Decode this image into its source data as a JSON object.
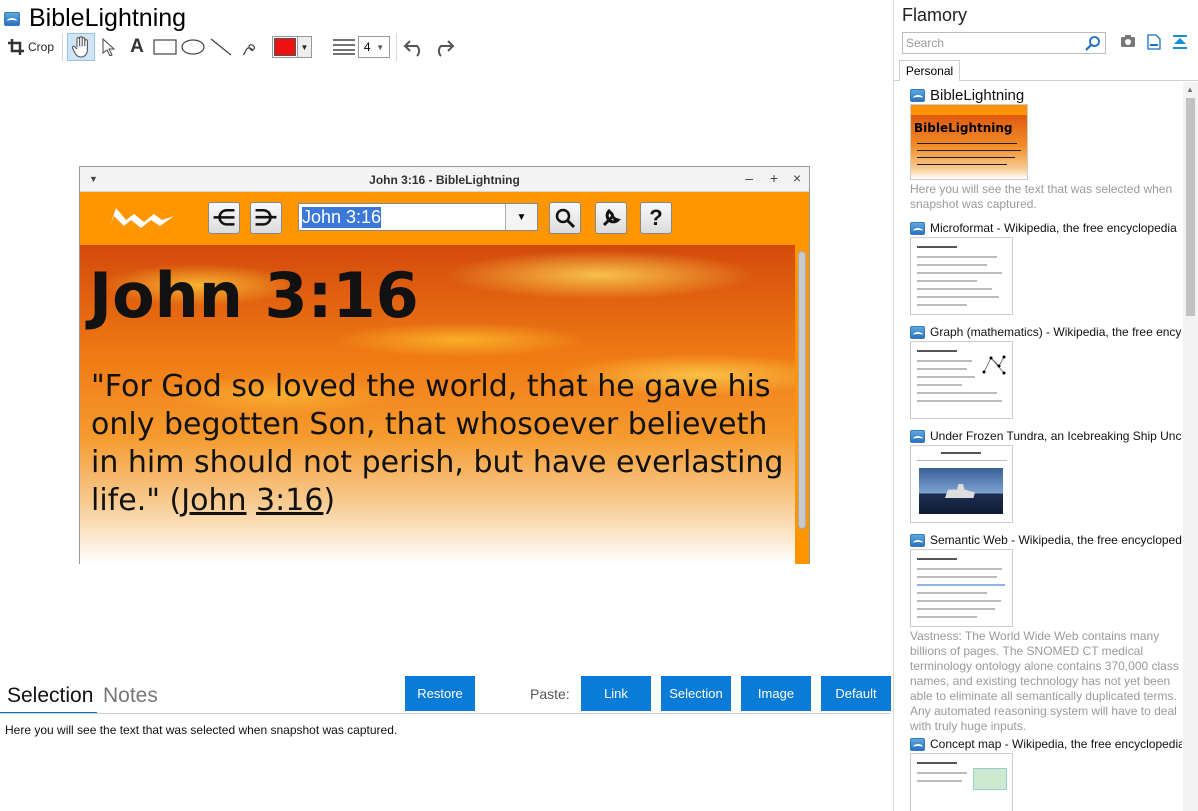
{
  "window": {
    "title": "BibleLightning"
  },
  "toolbar": {
    "crop_label": "Crop",
    "color_value": "#ee1111",
    "line_width": "4",
    "tools": [
      "hand-icon",
      "pointer-icon",
      "text-icon",
      "rectangle-icon",
      "ellipse-icon",
      "line-icon",
      "freehand-icon",
      "color-picker",
      "line-width-icon",
      "undo-icon",
      "redo-icon"
    ]
  },
  "snapshot": {
    "window_title": "John 3:16 - BibleLightning",
    "search_value": "John 3:16",
    "heading": "John 3:16",
    "verse_text": "\"For God so loved the world, that he gave his only begotten Son, that whosoever believeth in him should not perish, but have everlasting life.\" (",
    "link_book": "John",
    "link_ref": "3:16",
    "verse_close": ")",
    "buttons": [
      "back-icon",
      "forward-icon",
      "search-icon",
      "settings-icon",
      "help-icon"
    ],
    "accent_color": "#ff9500"
  },
  "bottom": {
    "tabs": [
      "Selection",
      "Notes"
    ],
    "restore_label": "Restore",
    "paste_label": "Paste:",
    "paste_buttons": [
      "Link",
      "Selection",
      "Image",
      "Default"
    ],
    "selection_text": "Here you will see the text that was selected when snapshot was captured.",
    "button_color": "#0a7bd7"
  },
  "sidebar": {
    "brand": "Flamory",
    "search_placeholder": "Search",
    "tab": "Personal",
    "items": [
      {
        "title": "BibleLightning",
        "desc": "Here you will see the text that was selected when snapshot was captured."
      },
      {
        "title": "Microformat - Wikipedia, the free encyclopedia",
        "desc": ""
      },
      {
        "title": "Graph (mathematics) - Wikipedia, the free encyclopedia",
        "desc": ""
      },
      {
        "title": "Under Frozen Tundra, an Icebreaking Ship Uncovers",
        "desc": ""
      },
      {
        "title": "Semantic Web - Wikipedia, the free encyclopedia",
        "desc": "Vastness: The World Wide Web contains many billions of pages. The SNOMED CT medical terminology ontology alone contains 370,000 class names, and existing technology has not yet been able to eliminate all semantically duplicated terms. Any automated reasoning system will have to deal with truly huge inputs."
      },
      {
        "title": "Concept map - Wikipedia, the free encyclopedia",
        "desc": ""
      }
    ]
  }
}
